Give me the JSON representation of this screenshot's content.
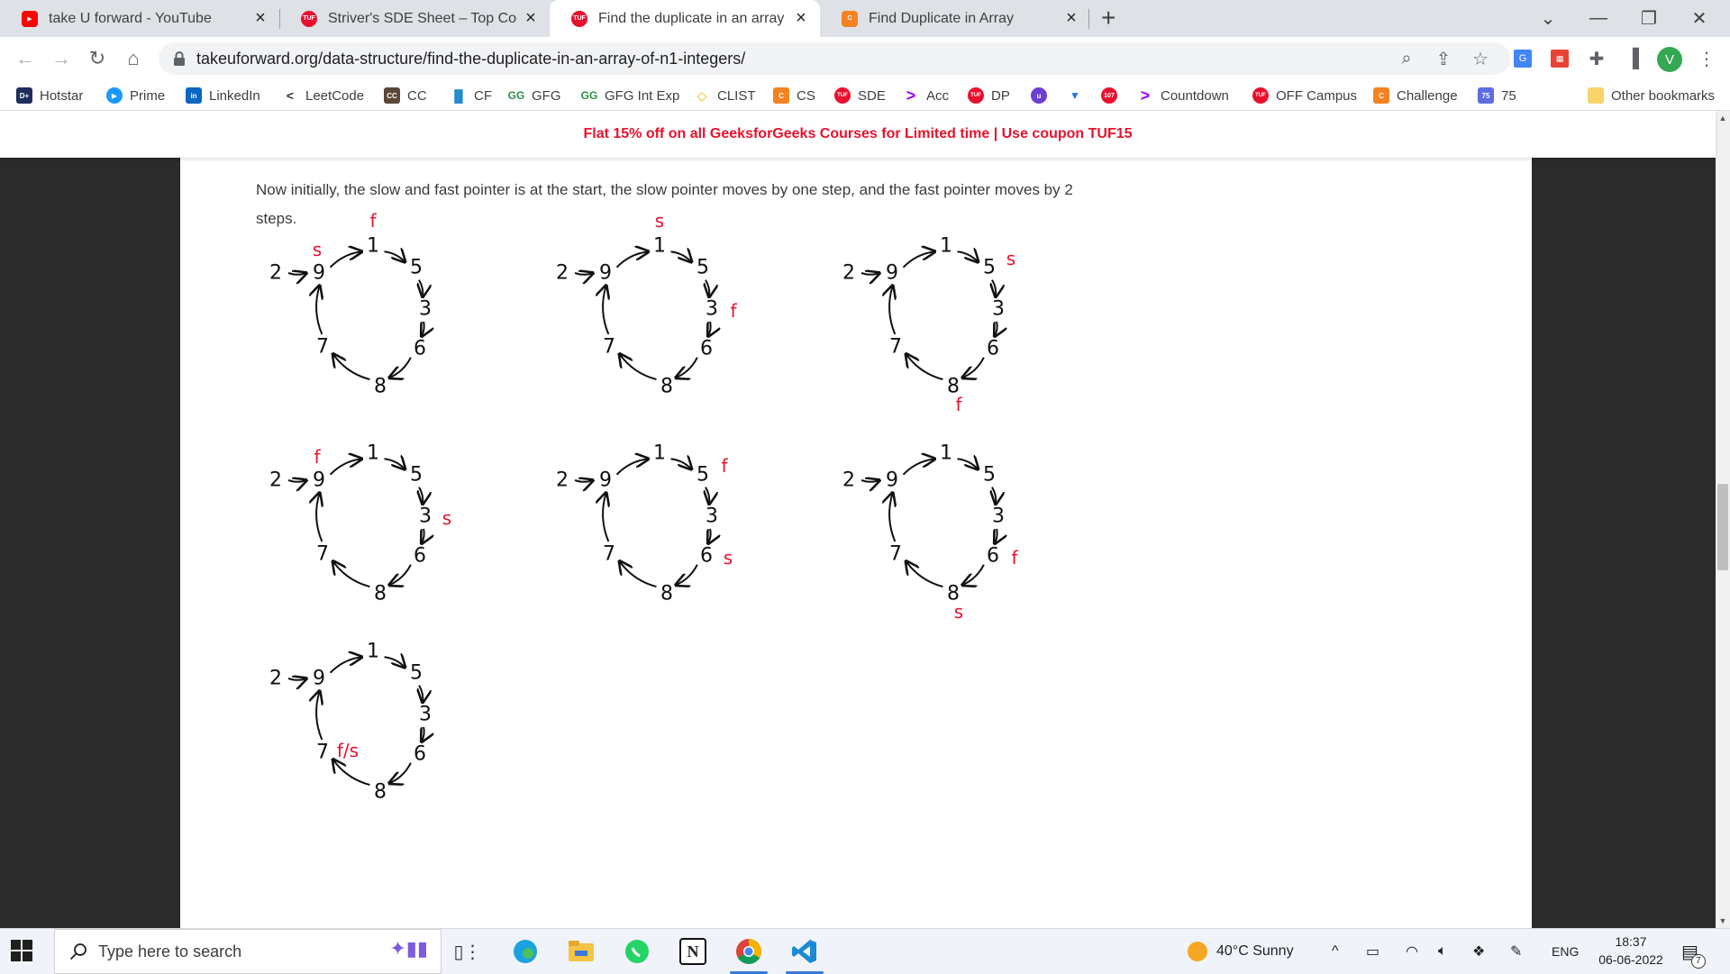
{
  "tabs": [
    {
      "title": "take U forward - YouTube",
      "icon": "youtube-icon",
      "active": false
    },
    {
      "title": "Striver's SDE Sheet – Top Coding",
      "icon": "tuf-icon",
      "active": false
    },
    {
      "title": "Find the duplicate in an array of N",
      "icon": "tuf-icon",
      "active": true
    },
    {
      "title": "Find Duplicate in Array",
      "icon": "codestudio-icon",
      "active": false
    }
  ],
  "toolbar": {
    "url": "takeuforward.org/data-structure/find-the-duplicate-in-an-array-of-n1-integers/",
    "profile_initial": "V"
  },
  "bookmarks": [
    {
      "label": "Hotstar",
      "icon": "hotstar-icon",
      "color": "#1f2d5c"
    },
    {
      "label": "Prime",
      "icon": "prime-icon",
      "color": "#1a98ff"
    },
    {
      "label": "LinkedIn",
      "icon": "linkedin-icon",
      "color": "#0a66c2"
    },
    {
      "label": "LeetCode",
      "icon": "leetcode-icon",
      "color": "#ffa116"
    },
    {
      "label": "CC",
      "icon": "codechef-icon",
      "color": "#5b4638"
    },
    {
      "label": "CF",
      "icon": "codeforces-icon",
      "color": "#1f8acb"
    },
    {
      "label": "GFG",
      "icon": "gfg-icon",
      "color": "#2f8d46"
    },
    {
      "label": "GFG Int Exp",
      "icon": "gfg-icon",
      "color": "#2f8d46"
    },
    {
      "label": "CLIST",
      "icon": "clist-icon",
      "color": "#f0b400"
    },
    {
      "label": "CS",
      "icon": "codestudio-icon",
      "color": "#f58220"
    },
    {
      "label": "SDE",
      "icon": "tuf-icon",
      "color": "#e8112d"
    },
    {
      "label": "Acc",
      "icon": "accenture-icon",
      "color": "#a100ff"
    },
    {
      "label": "DP",
      "icon": "tuf-icon",
      "color": "#e8112d"
    },
    {
      "label": "",
      "icon": "unacademy-icon",
      "color": "#6b3fd1"
    },
    {
      "label": "",
      "icon": "bookmark-icon",
      "color": "#1a73e8"
    },
    {
      "label": "",
      "icon": "notification-icon",
      "color": "#e8112d"
    },
    {
      "label": "Countdown",
      "icon": "accenture-icon",
      "color": "#a100ff"
    },
    {
      "label": "OFF Campus",
      "icon": "tuf-icon",
      "color": "#e8112d"
    },
    {
      "label": "Challenge",
      "icon": "codestudio-icon",
      "color": "#f58220"
    },
    {
      "label": "75",
      "icon": "blind75-icon",
      "color": "#5b6ee1"
    },
    {
      "label": "Other bookmarks",
      "icon": "folder-icon",
      "color": "#f6d36b"
    }
  ],
  "page": {
    "announcement": "Flat 15% off on all GeeksforGeeks Courses for Limited time | Use coupon TUF15",
    "paragraph": "Now initially, the slow and fast pointer is at the start, the slow pointer moves by one step, and the fast pointer moves by 2 steps."
  },
  "diagram": {
    "entry": "2",
    "cycle_nodes": [
      "9",
      "1",
      "5",
      "3",
      "6",
      "8",
      "7"
    ],
    "panels": [
      {
        "labels": [
          {
            "node": "9",
            "text": "s"
          },
          {
            "node": "1",
            "text": "f"
          }
        ]
      },
      {
        "labels": [
          {
            "node": "1",
            "text": "s"
          },
          {
            "node": "3",
            "text": "f"
          }
        ]
      },
      {
        "labels": [
          {
            "node": "5",
            "text": "s"
          },
          {
            "node": "8",
            "text": "f"
          }
        ]
      },
      {
        "labels": [
          {
            "node": "9",
            "text": "f"
          },
          {
            "node": "3",
            "text": "s"
          }
        ]
      },
      {
        "labels": [
          {
            "node": "5",
            "text": "f"
          },
          {
            "node": "6",
            "text": "s"
          }
        ]
      },
      {
        "labels": [
          {
            "node": "8",
            "text": "s"
          },
          {
            "node": "6",
            "text": "f"
          }
        ]
      },
      {
        "labels": [
          {
            "node": "7",
            "text": "f/s"
          }
        ]
      }
    ]
  },
  "taskbar": {
    "search_placeholder": "Type here to search",
    "weather": "40°C  Sunny",
    "language": "ENG",
    "time": "18:37",
    "date": "06-06-2022",
    "notification_count": "7"
  }
}
